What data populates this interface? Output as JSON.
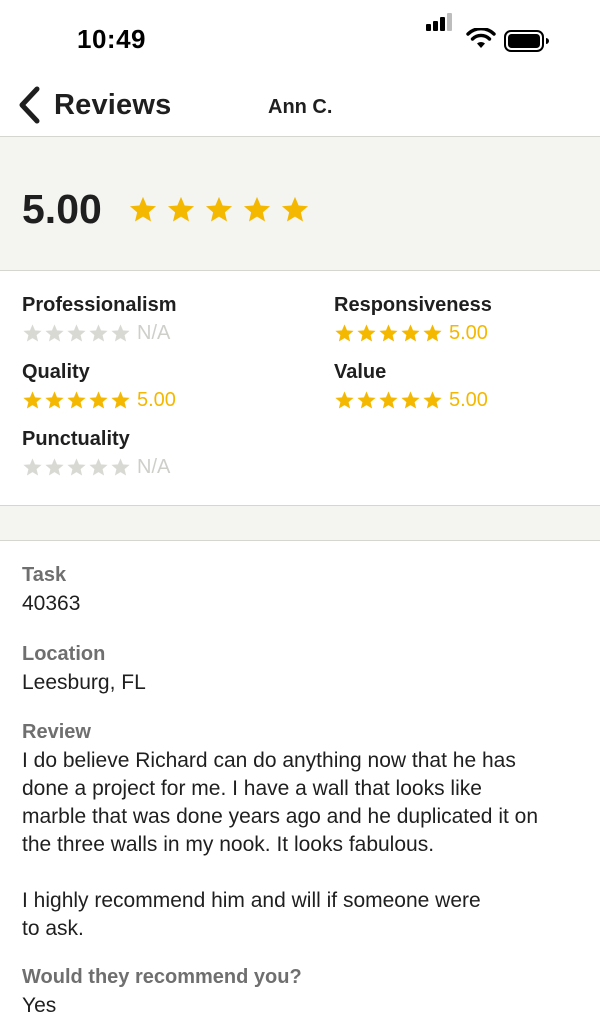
{
  "status_bar": {
    "time": "10:49"
  },
  "nav": {
    "back_label": "Reviews",
    "title": "Ann C."
  },
  "summary": {
    "score": "5.00",
    "stars": 5
  },
  "colors": {
    "star_filled": "#f5b800",
    "star_empty": "#d9d9d4",
    "band_bg": "#f4f4f1"
  },
  "ratings": [
    {
      "label": "Professionalism",
      "value": "N/A",
      "stars": 0
    },
    {
      "label": "Responsiveness",
      "value": "5.00",
      "stars": 5
    },
    {
      "label": "Quality",
      "value": "5.00",
      "stars": 5
    },
    {
      "label": "Value",
      "value": "5.00",
      "stars": 5
    },
    {
      "label": "Punctuality",
      "value": "N/A",
      "stars": 0
    }
  ],
  "details": {
    "task_label": "Task",
    "task_value": "40363",
    "location_label": "Location",
    "location_value": "Leesburg, FL",
    "review_label": "Review",
    "review_text": "I do believe Richard can do anything now that he has\ndone a project for me.  I have a wall that looks like\nmarble that was done years ago and he duplicated it on\nthe three walls in my nook.  It looks fabulous.\n\nI highly recommend him and will if someone were\nto ask.",
    "recommend_label": "Would they recommend you?",
    "recommend_value": "Yes"
  }
}
